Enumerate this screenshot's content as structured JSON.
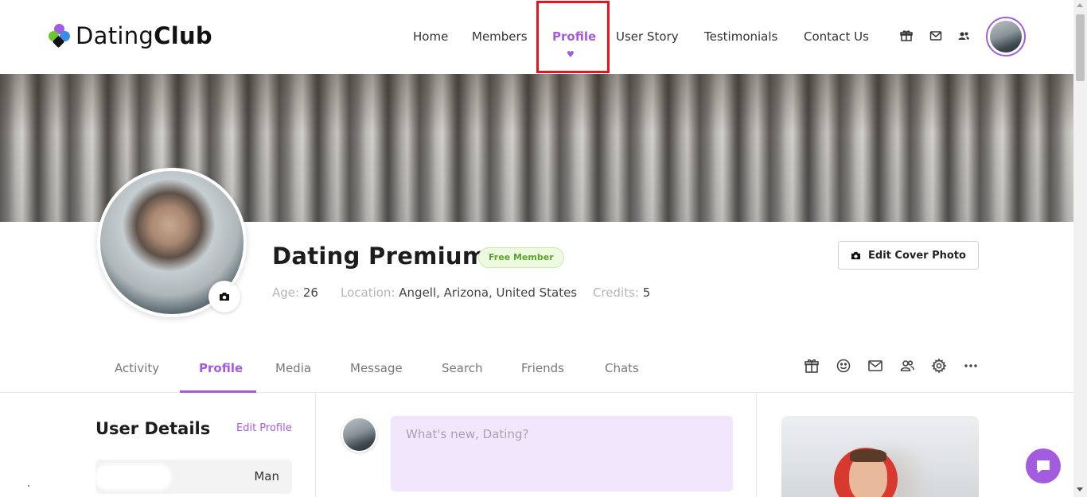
{
  "brand": {
    "name_light": "Dating",
    "name_bold": "Club",
    "colors": {
      "purple": "#a35ce0",
      "green": "#6ec532",
      "blue": "#3a8ee6",
      "yellow": "#f3c43a"
    }
  },
  "nav": {
    "items": [
      {
        "label": "Home"
      },
      {
        "label": "Members"
      },
      {
        "label": "Profile",
        "active": true
      },
      {
        "label": "User Story"
      },
      {
        "label": "Testimonials"
      },
      {
        "label": "Contact Us"
      }
    ],
    "icons": [
      "gift-icon",
      "mail-icon",
      "users-icon"
    ]
  },
  "profile": {
    "name": "Dating Premium",
    "badge": "Free Member",
    "age_label": "Age:",
    "age": "26",
    "location_label": "Location:",
    "location": "Angell, Arizona, United States",
    "credits_label": "Credits:",
    "credits": "5",
    "edit_cover_label": "Edit Cover Photo"
  },
  "tabs": [
    {
      "label": "Activity"
    },
    {
      "label": "Profile",
      "active": true
    },
    {
      "label": "Media"
    },
    {
      "label": "Message"
    },
    {
      "label": "Search"
    },
    {
      "label": "Friends"
    },
    {
      "label": "Chats"
    }
  ],
  "tab_icons": [
    "gift-icon",
    "smiley-icon",
    "mail-icon",
    "users-icon",
    "gear-icon",
    "more-icon"
  ],
  "user_details": {
    "title": "User Details",
    "edit_label": "Edit Profile",
    "rows": [
      {
        "value": "Man"
      }
    ]
  },
  "post": {
    "placeholder": "What's new, Dating?"
  },
  "accent_color": "#a35ce0",
  "highlight_color": "#e8141c"
}
